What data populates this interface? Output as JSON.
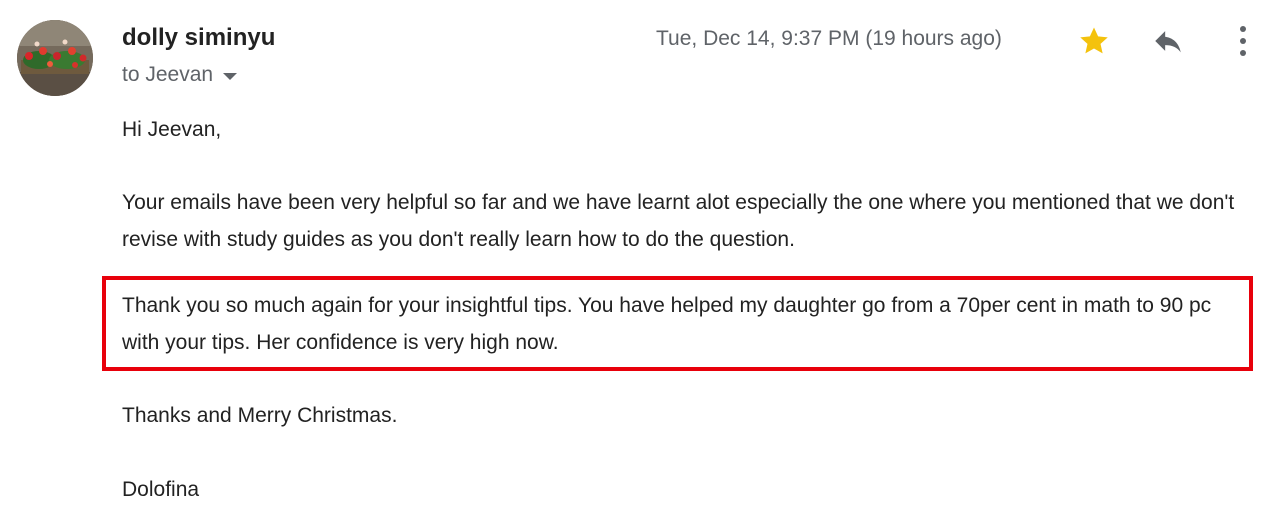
{
  "sender": {
    "name": "dolly siminyu",
    "avatar_icon": "profile-photo-flowers"
  },
  "recipient": {
    "label": "to Jeevan",
    "dropdown_icon": "chevron-down-icon"
  },
  "timestamp": "Tue, Dec 14, 9:37 PM (19 hours ago)",
  "actions": {
    "star_icon": "star-icon",
    "star_color": "#f4c20d",
    "reply_icon": "reply-icon",
    "more_icon": "more-vert-icon"
  },
  "message": {
    "greeting": "Hi Jeevan,",
    "paragraph1": "Your emails have been very helpful so far and we have learnt alot especially the one where you mentioned that we don't revise with study guides as you don't really learn how to do the question.",
    "paragraph2": "Thank you so much again for your insightful tips. You have helped my daughter go from a 70per cent in math to 90 pc with your tips. Her confidence is very high now.",
    "signoff": "Thanks and Merry Christmas.",
    "signature": "Dolofina"
  },
  "highlight_color": "#e8000b"
}
